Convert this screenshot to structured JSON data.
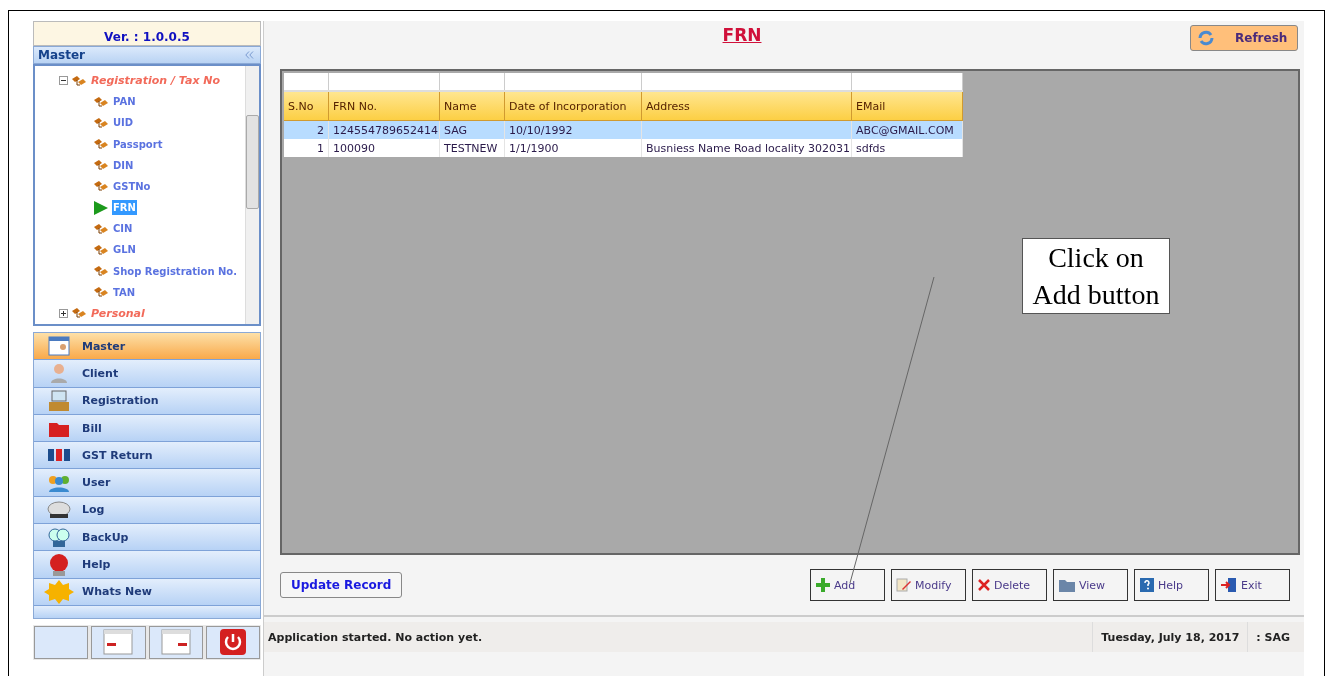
{
  "sidebar": {
    "version": "Ver. : 1.0.0.5",
    "header": "Master",
    "tree": [
      {
        "label": "Registration / Tax No",
        "expanded": true,
        "selected": false,
        "children": [
          {
            "label": "PAN",
            "selected": false
          },
          {
            "label": "UID",
            "selected": false
          },
          {
            "label": "Passport",
            "selected": false
          },
          {
            "label": "DIN",
            "selected": false
          },
          {
            "label": "GSTNo",
            "selected": false
          },
          {
            "label": "FRN",
            "selected": true
          },
          {
            "label": "CIN",
            "selected": false
          },
          {
            "label": "GLN",
            "selected": false
          },
          {
            "label": "Shop Registration No.",
            "selected": false
          },
          {
            "label": "TAN",
            "selected": false
          }
        ]
      },
      {
        "label": "Personal",
        "expanded": false,
        "selected": false
      }
    ],
    "nav": [
      {
        "label": "Master",
        "selected": true
      },
      {
        "label": "Client",
        "selected": false
      },
      {
        "label": "Registration",
        "selected": false
      },
      {
        "label": "Bill",
        "selected": false
      },
      {
        "label": "GST Return",
        "selected": false
      },
      {
        "label": "User",
        "selected": false
      },
      {
        "label": "Log",
        "selected": false
      },
      {
        "label": "BackUp",
        "selected": false
      },
      {
        "label": "Help",
        "selected": false
      },
      {
        "label": "Whats New",
        "selected": false
      }
    ]
  },
  "main": {
    "title": "FRN",
    "refresh": "Refresh",
    "table": {
      "columns": [
        "S.No",
        "FRN No.",
        "Name",
        "Date of Incorporation",
        "Address",
        "EMail"
      ],
      "rows": [
        {
          "selected": true,
          "cells": [
            "2",
            "124554789652414",
            "SAG",
            "10/10/1992",
            "",
            "ABC@GMAIL.COM"
          ]
        },
        {
          "selected": false,
          "cells": [
            "1",
            "100090",
            "TESTNEW",
            "1/1/1900",
            "Busniess Name Road locality 302031",
            "sdfds"
          ]
        }
      ]
    },
    "callout": "Click on Add button",
    "update": "Update Record",
    "buttons": [
      "Add",
      "Modify",
      "Delete",
      "View",
      "Help",
      "Exit"
    ]
  },
  "status_bar": {
    "message": "Application started. No action yet.",
    "date": "Tuesday, July 18, 2017",
    "user": ": SAG"
  }
}
